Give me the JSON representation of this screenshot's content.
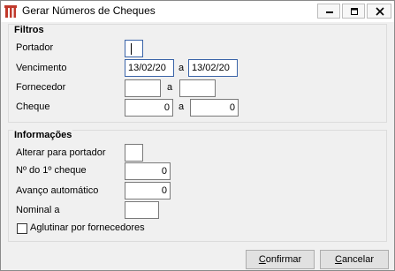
{
  "window": {
    "title": "Gerar Números de Cheques",
    "icon": "app-logo-icon"
  },
  "filtros": {
    "title": "Filtros",
    "portador_label": "Portador",
    "portador_value": "",
    "vencimento_label": "Vencimento",
    "vencimento_from": "13/02/20",
    "vencimento_sep": "a",
    "vencimento_to": "13/02/20",
    "fornecedor_label": "Fornecedor",
    "fornecedor_from": "",
    "fornecedor_sep": "a",
    "fornecedor_to": "",
    "cheque_label": "Cheque",
    "cheque_from": "0",
    "cheque_sep": "a",
    "cheque_to": "0"
  },
  "informacoes": {
    "title": "Informações",
    "alterar_label": "Alterar para portador",
    "alterar_value": "",
    "numero_label": "Nº do 1º cheque",
    "numero_value": "0",
    "avanco_label": "Avanço automático",
    "avanco_value": "0",
    "nominal_label": "Nominal a",
    "nominal_value": "",
    "aglutinar_label": "Aglutinar por fornecedores",
    "aglutinar_checked": false
  },
  "buttons": {
    "confirm_prefix": "C",
    "confirm_rest": "onfirmar",
    "cancel_prefix": "C",
    "cancel_rest": "ancelar"
  }
}
